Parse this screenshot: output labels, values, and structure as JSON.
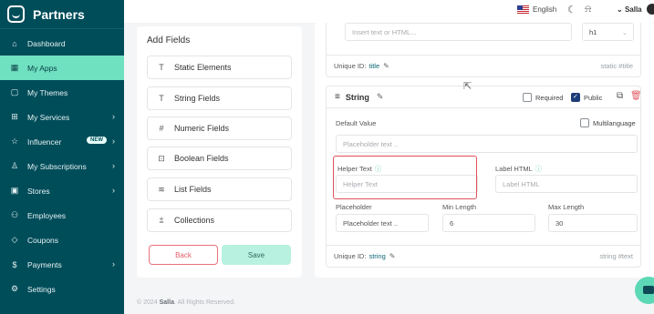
{
  "brand": {
    "name": "Partners"
  },
  "sidebar": {
    "items": [
      {
        "label": "Dashboard",
        "icon": "⌂"
      },
      {
        "label": "My Apps",
        "icon": "▦"
      },
      {
        "label": "My Themes",
        "icon": "▢"
      },
      {
        "label": "My Services",
        "icon": "⊞",
        "chevron": "›"
      },
      {
        "label": "Influencer",
        "icon": "☆",
        "badge": "NEW",
        "chevron": "›"
      },
      {
        "label": "My Subscriptions",
        "icon": "♙",
        "chevron": "›"
      },
      {
        "label": "Stores",
        "icon": "▣",
        "chevron": "›"
      },
      {
        "label": "Employees",
        "icon": "⚇"
      },
      {
        "label": "Coupons",
        "icon": "◇"
      },
      {
        "label": "Payments",
        "icon": "$",
        "chevron": "›"
      },
      {
        "label": "Settings",
        "icon": "⚙"
      }
    ]
  },
  "topbar": {
    "language": "English",
    "user": "Salla"
  },
  "add_fields": {
    "title": "Add Fields",
    "types": [
      {
        "label": "Static Elements",
        "icon": "T"
      },
      {
        "label": "String Fields",
        "icon": "T"
      },
      {
        "label": "Numeric Fields",
        "icon": "#"
      },
      {
        "label": "Boolean Fields",
        "icon": "⊡"
      },
      {
        "label": "List Fields",
        "icon": "≋"
      },
      {
        "label": "Collections",
        "icon": "⩲"
      }
    ],
    "back_label": "Back",
    "save_label": "Save"
  },
  "title_card": {
    "input_placeholder": "Insert text or HTML...",
    "tag_select": "h1",
    "uid_label": "Unique ID:",
    "uid_value": "title",
    "tag": "static #title"
  },
  "string_card": {
    "title": "String",
    "required_label": "Required",
    "public_label": "Public",
    "default_value_label": "Default Value",
    "multilanguage_label": "Multilanguage",
    "default_placeholder": "Placeholder text ..",
    "helper_text_label": "Helper Text",
    "helper_text_placeholder": "Helper Text",
    "label_html_label": "Label HTML",
    "label_html_placeholder": "Label HTML",
    "placeholder_label": "Placeholder",
    "placeholder_value": "Placeholder text ..",
    "min_length_label": "Min Length",
    "min_length_value": "6",
    "max_length_label": "Max Length",
    "max_length_value": "30",
    "uid_label": "Unique ID:",
    "uid_value": "string",
    "tag": "string #text"
  },
  "footer": {
    "prefix": "© 2024 ",
    "brand": "Salla",
    "suffix": ". All Rights Reserved."
  }
}
